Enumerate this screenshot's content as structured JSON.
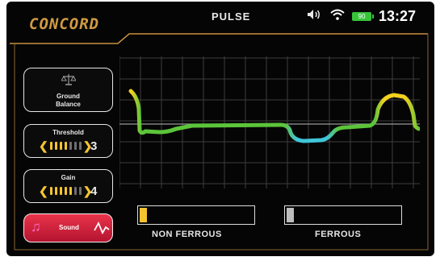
{
  "header": {
    "logo": "CONCORD",
    "mode": "PULSE",
    "battery": "90",
    "clock": "13:27"
  },
  "icons": {
    "speaker": "speaker-icon",
    "wifi": "wifi-icon",
    "battery": "battery-icon",
    "balance": "scale-icon",
    "note": "music-note-icon",
    "wave": "waveform-icon"
  },
  "sidebar": {
    "ground_balance": {
      "label_line1": "Ground",
      "label_line2": "Balance"
    },
    "threshold": {
      "label": "Threshold",
      "value": "3",
      "level_fraction": 0.45
    },
    "gain": {
      "label": "Gain",
      "value": "4",
      "level_fraction": 0.6
    },
    "sound": {
      "label": "Sound"
    }
  },
  "meters": {
    "non_ferrous": {
      "label": "NON FERROUS",
      "color": "#f4c430"
    },
    "ferrous": {
      "label": "FERROUS",
      "color": "#bdbdbd"
    }
  },
  "colors": {
    "accent_gold": "#d19a42",
    "signal_green": "#5bc43a",
    "signal_yellow": "#f4d21e",
    "signal_cyan": "#3fc6d8",
    "sound_red": "#d8223c"
  }
}
